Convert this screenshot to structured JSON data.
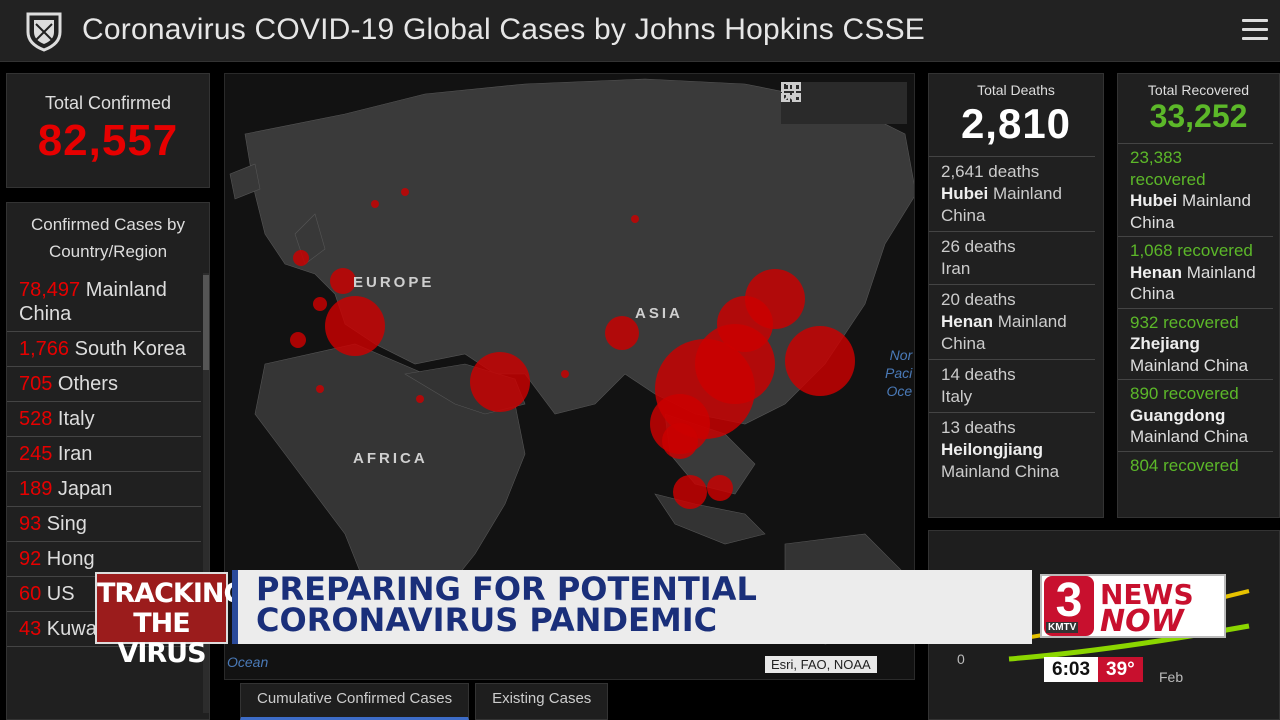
{
  "header": {
    "title": "Coronavirus COVID-19 Global Cases by Johns Hopkins CSSE"
  },
  "total_confirmed": {
    "label": "Total Confirmed",
    "value": "82,557"
  },
  "country_list": {
    "header": "Confirmed Cases by Country/Region",
    "items": [
      {
        "count": "78,497",
        "name": " Mainland China"
      },
      {
        "count": "1,766",
        "name": " South Korea"
      },
      {
        "count": "705",
        "name": " Others"
      },
      {
        "count": "528",
        "name": " Italy"
      },
      {
        "count": "245",
        "name": " Iran"
      },
      {
        "count": "189",
        "name": " Japan"
      },
      {
        "count": "93",
        "name": " Sing"
      },
      {
        "count": "92",
        "name": " Hong"
      },
      {
        "count": "60",
        "name": " US"
      },
      {
        "count": "43",
        "name": " Kuwait"
      }
    ]
  },
  "map": {
    "labels": {
      "europe": "EUROPE",
      "asia": "ASIA",
      "africa": "AFRICA"
    },
    "ocean_pacific": [
      "Nor",
      "Paci",
      "Oce"
    ],
    "ocean_atlantic": "Ocean",
    "attribution": "Esri, FAO, NOAA",
    "tools": [
      "bookmark-icon",
      "list-icon",
      "qr-grid-icon"
    ]
  },
  "tabs": [
    "Cumulative Confirmed Cases",
    "Existing Cases"
  ],
  "total_deaths": {
    "label": "Total Deaths",
    "value": "2,810",
    "items": [
      {
        "count": "2,641 deaths",
        "region": "Hubei",
        "rest": " Mainland China"
      },
      {
        "count": "26 deaths",
        "region": "",
        "rest": " Iran"
      },
      {
        "count": "20 deaths",
        "region": "Henan",
        "rest": " Mainland China"
      },
      {
        "count": "14 deaths",
        "region": "",
        "rest": " Italy"
      },
      {
        "count": "13 deaths",
        "region": "Heilongjiang",
        "rest": " Mainland China"
      }
    ]
  },
  "total_recovered": {
    "label": "Total Recovered",
    "value": "33,252",
    "items": [
      {
        "count": "23,383 recovered",
        "region": "Hubei",
        "rest": " Mainland China"
      },
      {
        "count": "1,068 recovered",
        "region": "Henan",
        "rest": " Mainland China"
      },
      {
        "count": "932 recovered",
        "region": "Zhejiang",
        "rest": " Mainland China"
      },
      {
        "count": "890 recovered",
        "region": "Guangdong",
        "rest": " Mainland China"
      },
      {
        "count": "804 recovered",
        "region": "",
        "rest": ""
      }
    ]
  },
  "chart": {
    "zero": "0",
    "month": "Feb"
  },
  "lower_third": {
    "tag": "TRACKING THE VIRUS",
    "headline": "PREPARING FOR POTENTIAL CORONAVIRUS PANDEMIC"
  },
  "station": {
    "number": "3",
    "call": "KMTV",
    "news": "NEWS",
    "now": "NOW"
  },
  "clock": {
    "time": "6:03",
    "temp": "39°"
  },
  "colors": {
    "confirmed": "#e60000",
    "recovered": "#5cb829",
    "headline": "#1a2f7a"
  }
}
